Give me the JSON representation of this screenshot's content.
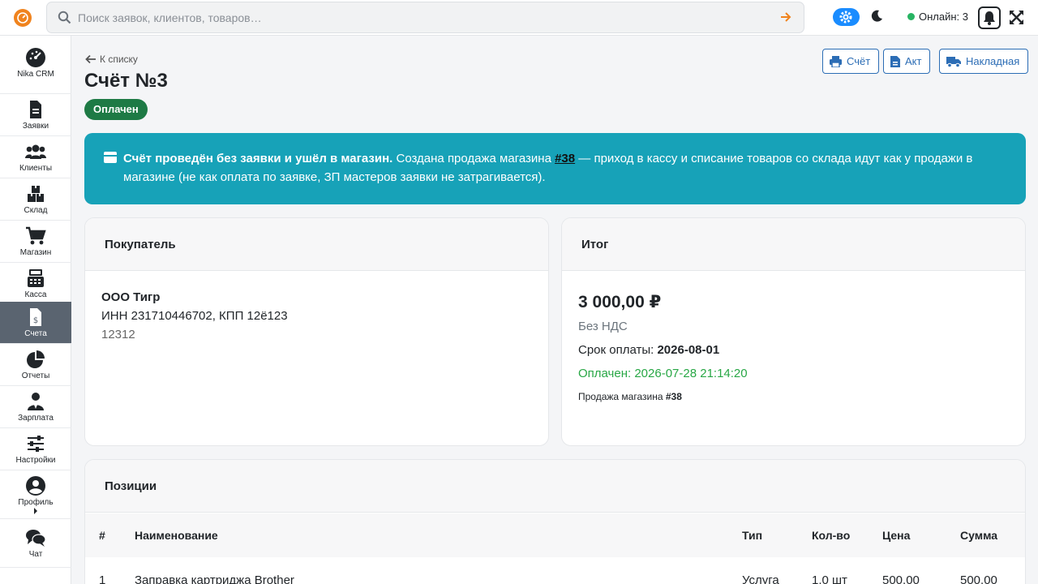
{
  "search": {
    "placeholder": "Поиск заявок, клиентов, товаров…"
  },
  "topbar": {
    "online_label": "Онлайн: 3"
  },
  "sidebar": {
    "items": [
      {
        "label": "Nika CRM",
        "icon": "dashboard-icon"
      },
      {
        "label": "Заявки",
        "icon": "document-icon"
      },
      {
        "label": "Клиенты",
        "icon": "users-icon"
      },
      {
        "label": "Склад",
        "icon": "boxes-icon"
      },
      {
        "label": "Магазин",
        "icon": "cart-icon"
      },
      {
        "label": "Касса",
        "icon": "cash-register-icon"
      },
      {
        "label": "Счета",
        "icon": "invoice-icon",
        "active": true
      },
      {
        "label": "Отчеты",
        "icon": "pie-chart-icon"
      },
      {
        "label": "Зарплата",
        "icon": "user-tie-icon"
      },
      {
        "label": "Настройки",
        "icon": "sliders-icon"
      },
      {
        "label": "Профиль",
        "icon": "profile-icon"
      },
      {
        "label": "Чат",
        "icon": "chat-icon"
      }
    ]
  },
  "page": {
    "back_label": "К списку",
    "title": "Счёт №3",
    "status": "Оплачен",
    "buttons": {
      "invoice": "Счёт",
      "act": "Акт",
      "waybill": "Накладная"
    }
  },
  "alert": {
    "bold": "Счёт проведён без заявки и ушёл в магазин.",
    "text1": " Создана продажа магазина ",
    "link": "#38",
    "text2": " — приход в кассу и списание товаров со склада идут как у продажи в магазине (не как оплата по заявке, ЗП мастеров заявки не затрагивается)."
  },
  "buyer": {
    "heading": "Покупатель",
    "name": "ООО Тигр",
    "inn": "ИНН 231710446702, КПП 12ё123",
    "note": "12312"
  },
  "total": {
    "heading": "Итог",
    "amount": "3 000,00 ₽",
    "vat": "Без НДС",
    "due_label": "Срок оплаты: ",
    "due_date": "2026-08-01",
    "paid": "Оплачен: 2026-07-28 21:14:20",
    "sale_label": "Продажа магазина ",
    "sale_ref": "#38"
  },
  "positions": {
    "heading": "Позиции",
    "columns": [
      "#",
      "Наименование",
      "Тип",
      "Кол-во",
      "Цена",
      "Сумма"
    ],
    "rows": [
      [
        "1",
        "Заправка картриджа Brother",
        "Услуга",
        "1.0 шт",
        "500.00",
        "500.00"
      ]
    ]
  },
  "colors": {
    "accent": "#2c6db5",
    "alert": "#17a2b8",
    "success": "#1e7a45",
    "active_nav": "#5a6470"
  }
}
